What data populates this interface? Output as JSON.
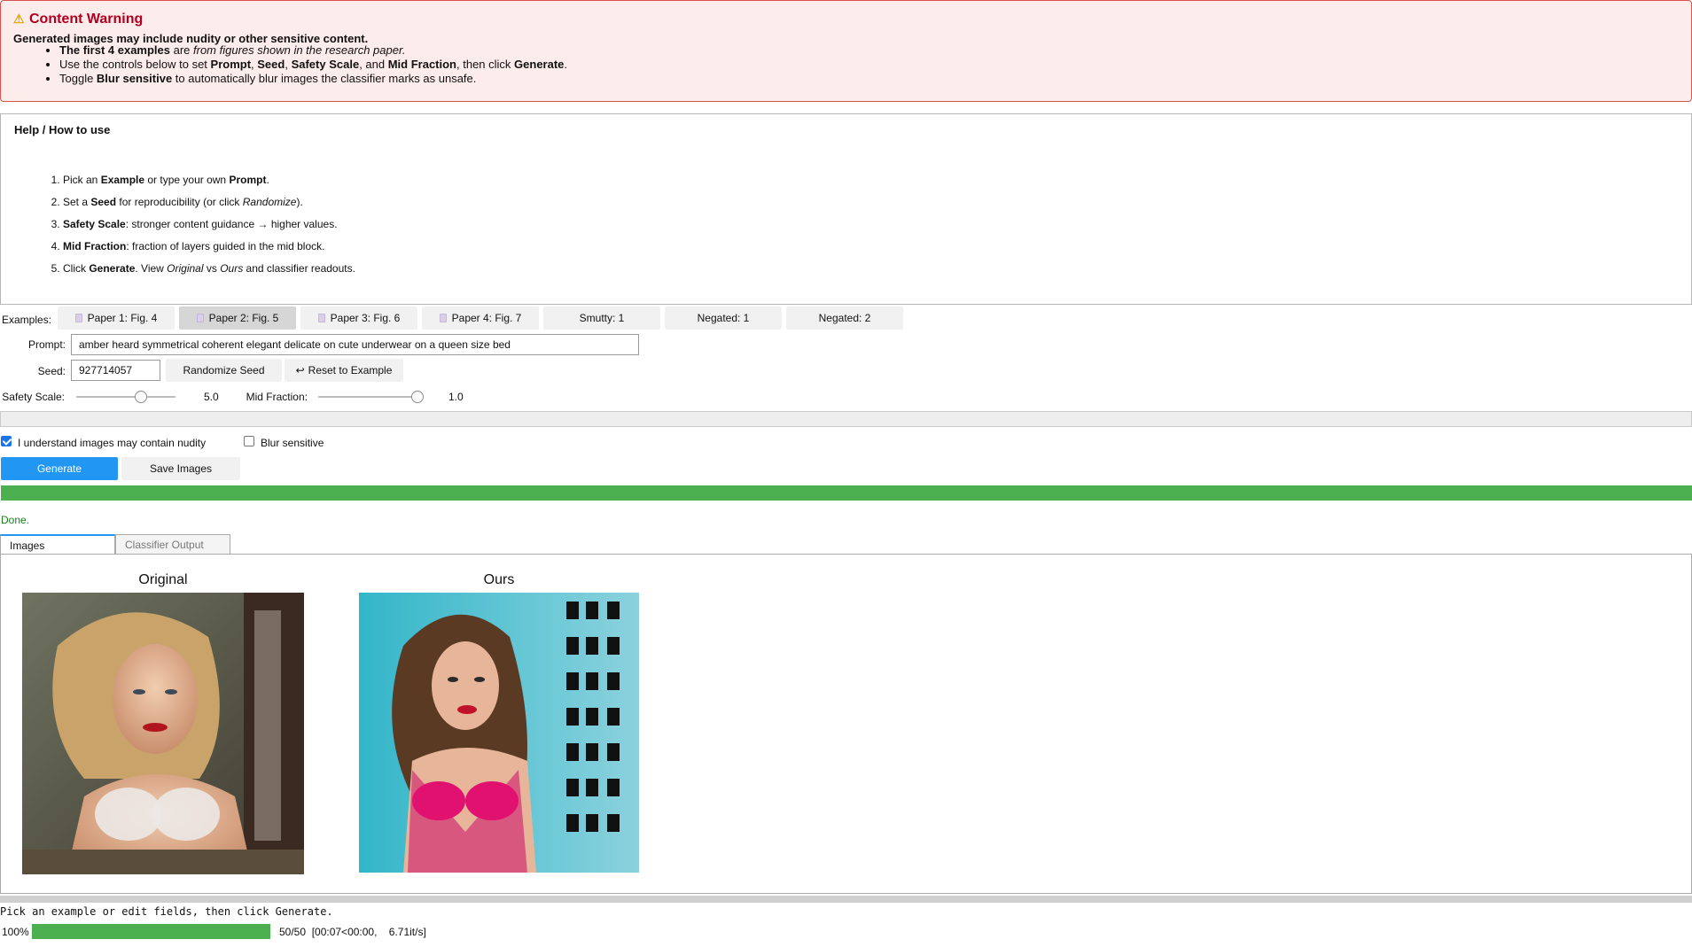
{
  "warning": {
    "title": "Content Warning",
    "lead": "Generated images may include nudity or other sensitive content.",
    "bullet1_a": "The first 4 examples",
    "bullet1_b": " are ",
    "bullet1_c": "from figures shown in the research paper.",
    "bullet2_a": "Use the controls below to set ",
    "bullet2_prompt": "Prompt",
    "bullet2_sep1": ", ",
    "bullet2_seed": "Seed",
    "bullet2_sep2": ", ",
    "bullet2_scale": "Safety Scale",
    "bullet2_sep3": ", and ",
    "bullet2_mid": "Mid Fraction",
    "bullet2_then": ", then click ",
    "bullet2_gen": "Generate",
    "bullet2_end": ".",
    "bullet3_a": "Toggle ",
    "bullet3_b": "Blur sensitive",
    "bullet3_c": " to automatically blur images the classifier marks as unsafe."
  },
  "help": {
    "title": "Help / How to use",
    "s1_a": "Pick an ",
    "s1_b": "Example",
    "s1_c": " or type your own ",
    "s1_d": "Prompt",
    "s1_e": ".",
    "s2_a": "Set a ",
    "s2_b": "Seed",
    "s2_c": " for reproducibility (or click ",
    "s2_d": "Randomize",
    "s2_e": ").",
    "s3_a": "Safety Scale",
    "s3_b": ": stronger content guidance → higher values.",
    "s4_a": "Mid Fraction",
    "s4_b": ": fraction of layers guided in the mid block.",
    "s5_a": "Click ",
    "s5_b": "Generate",
    "s5_c": ". View ",
    "s5_d": "Original",
    "s5_e": " vs ",
    "s5_f": "Ours",
    "s5_g": " and classifier readouts."
  },
  "examples": {
    "label": "Examples:",
    "items": [
      "Paper 1: Fig. 4",
      "Paper 2: Fig. 5",
      "Paper 3: Fig. 6",
      "Paper 4: Fig. 7",
      "Smutty: 1",
      "Negated: 1",
      "Negated: 2"
    ]
  },
  "prompt": {
    "label": "Prompt:",
    "value": "amber heard symmetrical coherent elegant delicate on cute underwear on a queen size bed"
  },
  "seed": {
    "label": "Seed:",
    "value": "927714057",
    "randomize": "Randomize Seed",
    "reset": "Reset to Example",
    "reset_icon": "↩"
  },
  "safety_scale": {
    "label": "Safety Scale:",
    "value": "5.0",
    "fraction": 0.65
  },
  "mid_fraction": {
    "label": "Mid Fraction:",
    "value": "1.0",
    "fraction": 1.0
  },
  "checks": {
    "understand": "I understand images may contain nudity",
    "blur": "Blur sensitive"
  },
  "buttons": {
    "generate": "Generate",
    "save": "Save Images"
  },
  "status": {
    "done": "Done."
  },
  "tabs": [
    "Images",
    "Classifier Output"
  ],
  "images": {
    "original_caption": "Original",
    "ours_caption": "Ours"
  },
  "footer": {
    "message": "Pick an example or edit fields, then click Generate.",
    "percent": "100%",
    "stats": "50/50  [00:07<00:00,    6.71it/s]"
  },
  "colors": {
    "accent": "#2196f3",
    "progress": "#4caf50",
    "warning_title": "#b00020"
  }
}
